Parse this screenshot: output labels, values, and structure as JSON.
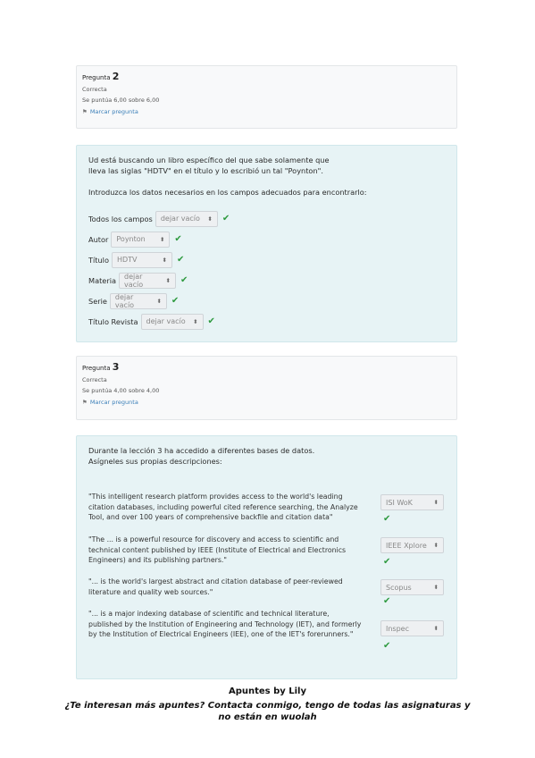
{
  "q2": {
    "label": "Pregunta",
    "number": "2",
    "status": "Correcta",
    "score": "Se puntúa 6,00 sobre 6,00",
    "flag_text": "Marcar pregunta"
  },
  "q2_content": {
    "intro_line1": "Ud está buscando un libro específico del que sabe solamente que",
    "intro_line2": "lleva las siglas \"HDTV\" en el título y lo escribió un tal \"Poynton\".",
    "instruction": "Introduzca los datos necesarios en los campos adecuados para encontrarlo:",
    "fields": [
      {
        "label": "Todos los campos",
        "value": "dejar vacío"
      },
      {
        "label": "Autor",
        "value": "Poynton"
      },
      {
        "label": "Título",
        "value": "HDTV"
      },
      {
        "label": "Materia",
        "value": "dejar vacío"
      },
      {
        "label": "Serie",
        "value": "dejar vacío"
      },
      {
        "label": "Título Revista",
        "value": "dejar vacío"
      }
    ]
  },
  "q3": {
    "label": "Pregunta",
    "number": "3",
    "status": "Correcta",
    "score": "Se puntúa 4,00 sobre 4,00",
    "flag_text": "Marcar pregunta"
  },
  "q3_content": {
    "intro_line1": "Durante la lección 3 ha accedido a diferentes bases de datos.",
    "intro_line2": "Asígneles sus propias descripciones:",
    "items": [
      {
        "text": "\"This intelligent research platform provides access to the world's leading citation databases, including powerful cited reference searching, the Analyze Tool, and over 100 years of comprehensive backfile and citation data\"",
        "answer": "ISI WoK"
      },
      {
        "text": "\"The ... is a powerful resource for discovery and access to scientific and technical content published by IEEE (Institute of Electrical and Electronics Engineers) and its publishing partners.\"",
        "answer": "IEEE Xplore"
      },
      {
        "text": "\"... is the world's largest abstract and citation database of peer-reviewed literature and quality web sources.\"",
        "answer": "Scopus"
      },
      {
        "text": "\"... is a major indexing database of scientific and technical literature, published by the Institution of Engineering and Technology (IET), and formerly by the Institution of Electrical Engineers (IEE), one of the IET's forerunners.\"",
        "answer": "Inspec"
      }
    ]
  },
  "footer": {
    "line1": "Apuntes by Lily",
    "line2": "¿Te interesan más apuntes? Contacta conmigo, tengo de todas las asignaturas y",
    "line3": "no están en wuolah"
  },
  "colors": {
    "check": "#2e9a3f",
    "content_bg": "#e7f3f5",
    "info_bg": "#f8f9fa",
    "link": "#3a7fb8"
  }
}
